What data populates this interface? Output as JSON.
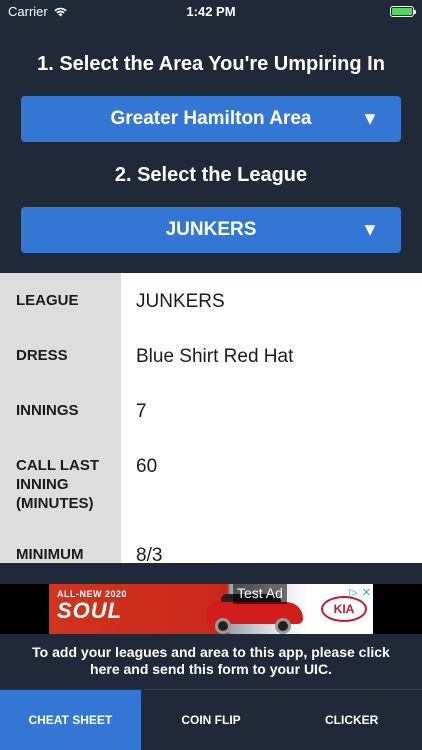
{
  "status_bar": {
    "carrier": "Carrier",
    "time": "1:42 PM",
    "battery_color": "#4cd964"
  },
  "section1": {
    "title": "1. Select the Area You're Umpiring In",
    "selected_area": "Greater Hamilton Area",
    "caret": "▼"
  },
  "section2": {
    "title": "2. Select the League",
    "selected_league": "JUNKERS",
    "caret": "▼"
  },
  "details": [
    {
      "label": "LEAGUE",
      "value": "JUNKERS"
    },
    {
      "label": "DRESS",
      "value": "Blue Shirt Red Hat"
    },
    {
      "label": "INNINGS",
      "value": "7"
    },
    {
      "label": "CALL LAST INNING (MINUTES)",
      "value": "60"
    },
    {
      "label": "MINIMUM",
      "value": "8/3"
    }
  ],
  "ad": {
    "small_text": "ALL-NEW 2020",
    "big_text": "SOUL",
    "tag": "Test Ad",
    "brand": "KIA",
    "choices": [
      "▷",
      "✕"
    ]
  },
  "notice": {
    "text": "To add your leagues and area to this app, please click here and send this form to your UIC."
  },
  "tabs": [
    {
      "label": "CHEAT SHEET",
      "active": true
    },
    {
      "label": "COIN FLIP",
      "active": false
    },
    {
      "label": "CLICKER",
      "active": false
    }
  ],
  "colors": {
    "background": "#202938",
    "accent": "#3476d4",
    "label_column": "#dddddd"
  }
}
